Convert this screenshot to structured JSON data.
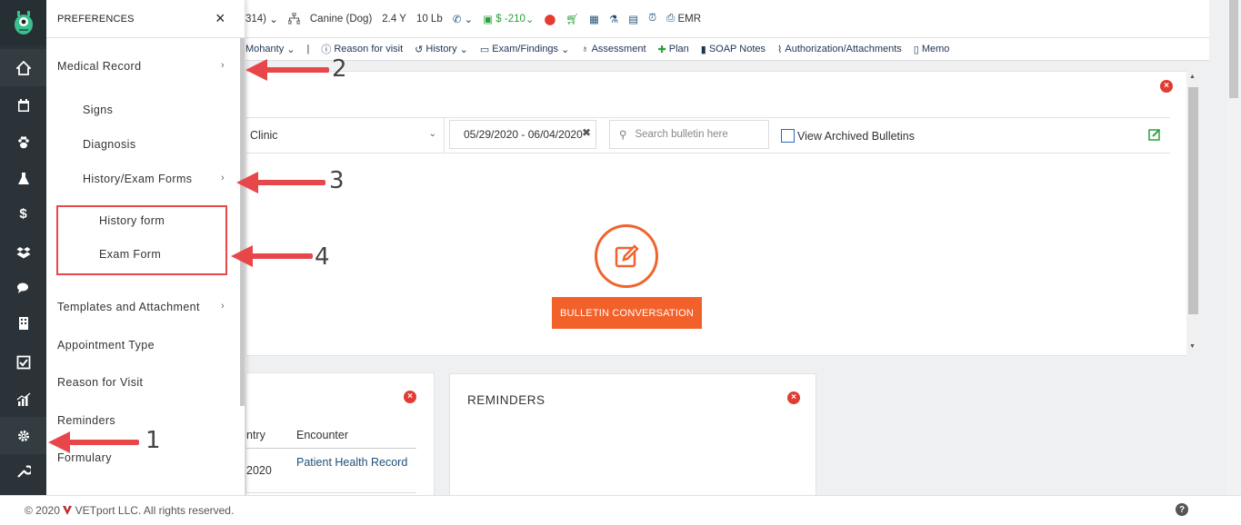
{
  "prefs": {
    "title": "PREFERENCES",
    "close": "×",
    "items": [
      {
        "label": "Medical Record",
        "chev": "›"
      },
      {
        "label": "Signs"
      },
      {
        "label": "Diagnosis"
      },
      {
        "label": "History/Exam Forms",
        "chev": "›"
      },
      {
        "label": "History form"
      },
      {
        "label": "Exam Form"
      },
      {
        "label": "Templates and Attachment",
        "chev": "›"
      },
      {
        "label": "Appointment Type"
      },
      {
        "label": "Reason for Visit"
      },
      {
        "label": "Reminders"
      },
      {
        "label": "Formulary"
      }
    ]
  },
  "topbar": {
    "id_fragment": "314)",
    "species": "Canine (Dog)",
    "age": "2.4 Y",
    "weight": "10 Lb",
    "balance": "$ -210",
    "emr": "EMR"
  },
  "subnav": {
    "doctor": "Mohanty",
    "separator": "|",
    "reason": "Reason for visit",
    "history": "History",
    "exam": "Exam/Findings",
    "assessment": "Assessment",
    "plan": "Plan",
    "soap": "SOAP Notes",
    "auth": "Authorization/Attachments",
    "memo": "Memo"
  },
  "bulletin": {
    "clinic": "Clinic",
    "daterange": "05/29/2020 - 06/04/2020",
    "search_placeholder": "Search bulletin here",
    "archived_label": "View Archived Bulletins",
    "button": "BULLETIN CONVERSATION"
  },
  "card1": {
    "col_a": "ntry",
    "col_b": "Encounter",
    "row_date": "2020",
    "row_link": "Patient Health Record"
  },
  "card2": {
    "title": "REMINDERS"
  },
  "footer": {
    "copyright": "© 2020",
    "company": "VETport LLC. All rights reserved.",
    "help": "?"
  },
  "annotations": [
    "2",
    "3",
    "4",
    "1"
  ],
  "colors": {
    "accent": "#f3612b",
    "sidebar": "#2b3338",
    "annotation": "#e8474a",
    "link": "#1f4f7a"
  }
}
